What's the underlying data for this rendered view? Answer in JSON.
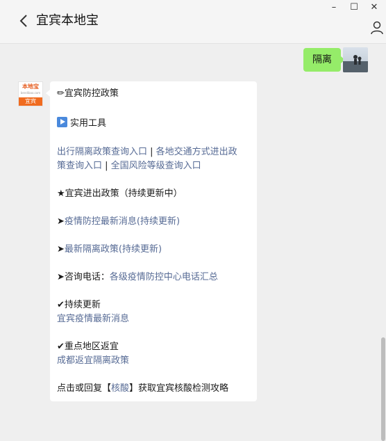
{
  "window": {
    "title": "宜宾本地宝",
    "minimize": "–",
    "maximize": "☐",
    "close": "✕"
  },
  "outgoing": {
    "text": "隔离"
  },
  "incoming": {
    "logo_top": "本地宝",
    "logo_url": "bendibao.com",
    "logo_bottom": "宜宾",
    "l1": "✏宜宾防控政策",
    "l2": "实用工具",
    "l3a": "出行隔离政策查询入口",
    "l3sep": " | ",
    "l3b": "各地交通方式进出政",
    "l4a": "策查询入口",
    "l4sep": " | ",
    "l4b": "全国风险等级查询入口",
    "l5": "★宜宾进出政策（持续更新中）",
    "l6pre": "➤",
    "l6": "疫情防控最新消息(持续更新)",
    "l7pre": "➤",
    "l7": "最新隔离政策(持续更新)",
    "l8pre": "➤咨询电话：",
    "l8": "各级疫情防控中心电话汇总",
    "l9": "✔持续更新",
    "l10": "宜宾疫情最新消息",
    "l11": "✔重点地区返宜",
    "l12": "成都返宜隔离政策",
    "l13a": "点击或回复【",
    "l13b": "核酸",
    "l13c": "】获取宜宾核酸检测攻略"
  }
}
